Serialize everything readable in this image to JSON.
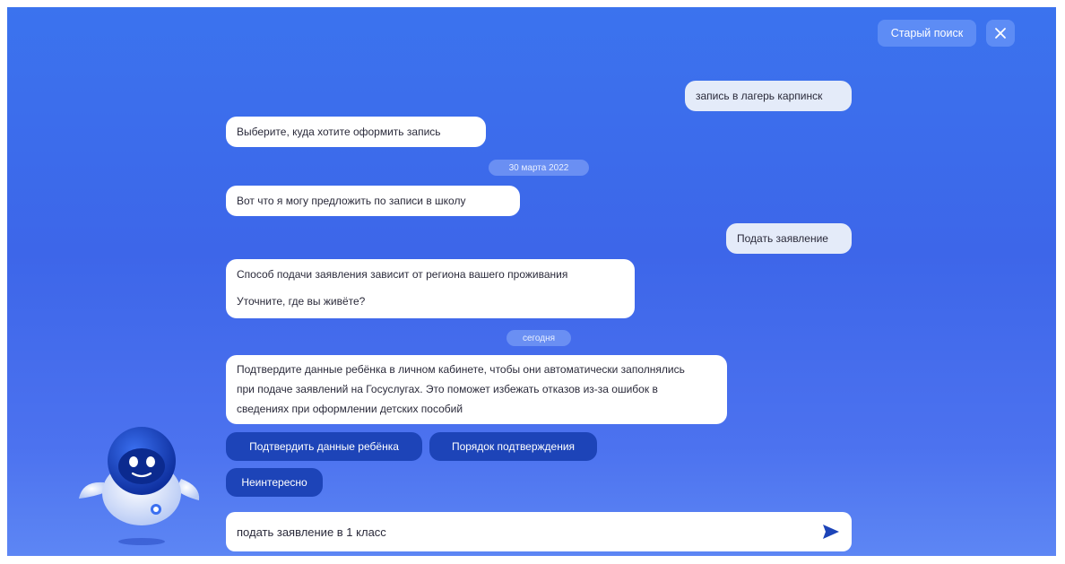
{
  "header": {
    "old_search_label": "Старый поиск",
    "close_icon": "close-icon"
  },
  "chat": {
    "user_msg_1": "запись в лагерь карпинск",
    "bot_msg_1": "Выберите, куда хотите оформить запись",
    "date_1": "30 марта 2022",
    "bot_msg_2": "Вот что я могу предложить по записи в школу",
    "user_msg_2": "Подать заявление",
    "bot_msg_3_line1": "Способ подачи заявления зависит от региона вашего проживания",
    "bot_msg_3_line2": "Уточните, где вы живёте?",
    "date_2": "сегодня",
    "bot_msg_4": "Подтвердите данные ребёнка в личном кабинете, чтобы они автоматически заполнялись при подаче заявлений на Госуслугах. Это поможет избежать отказов из-за ошибок в сведениях при оформлении детских пособий"
  },
  "quick_replies": {
    "confirm_child": "Подтвердить данные ребёнка",
    "confirm_order": "Порядок подтверждения",
    "not_interested": "Неинтересно"
  },
  "input": {
    "value": "подать заявление в 1 класс",
    "send_icon": "send-icon"
  },
  "assistant": {
    "avatar": "robot-assistant-avatar"
  },
  "colors": {
    "background": "#3d66e9",
    "quick_reply": "#1d44b8",
    "user_bubble": "#e4ebf9"
  }
}
